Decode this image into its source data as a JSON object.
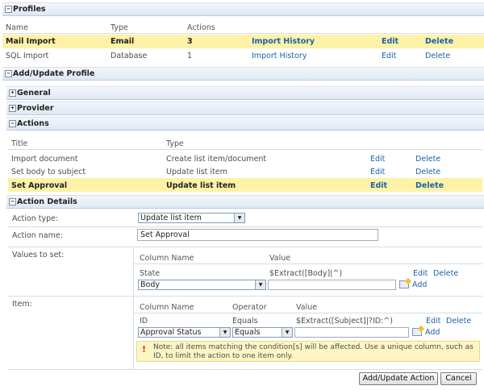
{
  "profiles": {
    "title": "Profiles",
    "headers": {
      "name": "Name",
      "type": "Type",
      "actions": "Actions"
    },
    "rows": [
      {
        "name": "Mail Import",
        "type": "Email",
        "actions": "3",
        "history": "Import History",
        "edit": "Edit",
        "delete": "Delete"
      },
      {
        "name": "SQL Import",
        "type": "Database",
        "actions": "1",
        "history": "Import History",
        "edit": "Edit",
        "delete": "Delete"
      }
    ]
  },
  "add_update_profile": {
    "title": "Add/Update Profile"
  },
  "general": {
    "title": "General"
  },
  "provider": {
    "title": "Provider"
  },
  "actions": {
    "title": "Actions",
    "headers": {
      "title": "Title",
      "type": "Type"
    },
    "rows": [
      {
        "title": "Import document",
        "type": "Create list item/document",
        "edit": "Edit",
        "delete": "Delete"
      },
      {
        "title": "Set body to subject",
        "type": "Update list item",
        "edit": "Edit",
        "delete": "Delete"
      },
      {
        "title": "Set Approval",
        "type": "Update list item",
        "edit": "Edit",
        "delete": "Delete"
      }
    ]
  },
  "action_details": {
    "title": "Action Details",
    "action_type_label": "Action type:",
    "action_type_value": "Update list item",
    "action_name_label": "Action name:",
    "action_name_value": "Set Approval",
    "values_label": "Values to set:",
    "values": {
      "col_header": "Column Name",
      "val_header": "Value",
      "row": {
        "column": "State",
        "value": "$Extract([Body]|^)",
        "edit": "Edit",
        "delete": "Delete"
      },
      "select_value": "Body",
      "add": "Add"
    },
    "item_label": "Item:",
    "item": {
      "col_header": "Column Name",
      "op_header": "Operator",
      "val_header": "Value",
      "row": {
        "column": "ID",
        "operator": "Equals",
        "value": "$Extract([Subject]|?ID:^)",
        "edit": "Edit",
        "delete": "Delete"
      },
      "column_select": "Approval Status",
      "operator_select": "Equals",
      "add": "Add",
      "note": "Note: all items matching the condition[s] will be affected. Use a unique column, such as ID, to limit the action to one item only."
    }
  },
  "buttons": {
    "submit": "Add/Update Action",
    "cancel": "Cancel"
  },
  "colors": {
    "highlight": "#fdf2a7",
    "link": "#1b62a8",
    "header": "#dfe7f3"
  },
  "icons": {
    "expanded": "minus-box",
    "collapsed": "plus-box",
    "note": "warning-icon",
    "add": "add-icon"
  }
}
